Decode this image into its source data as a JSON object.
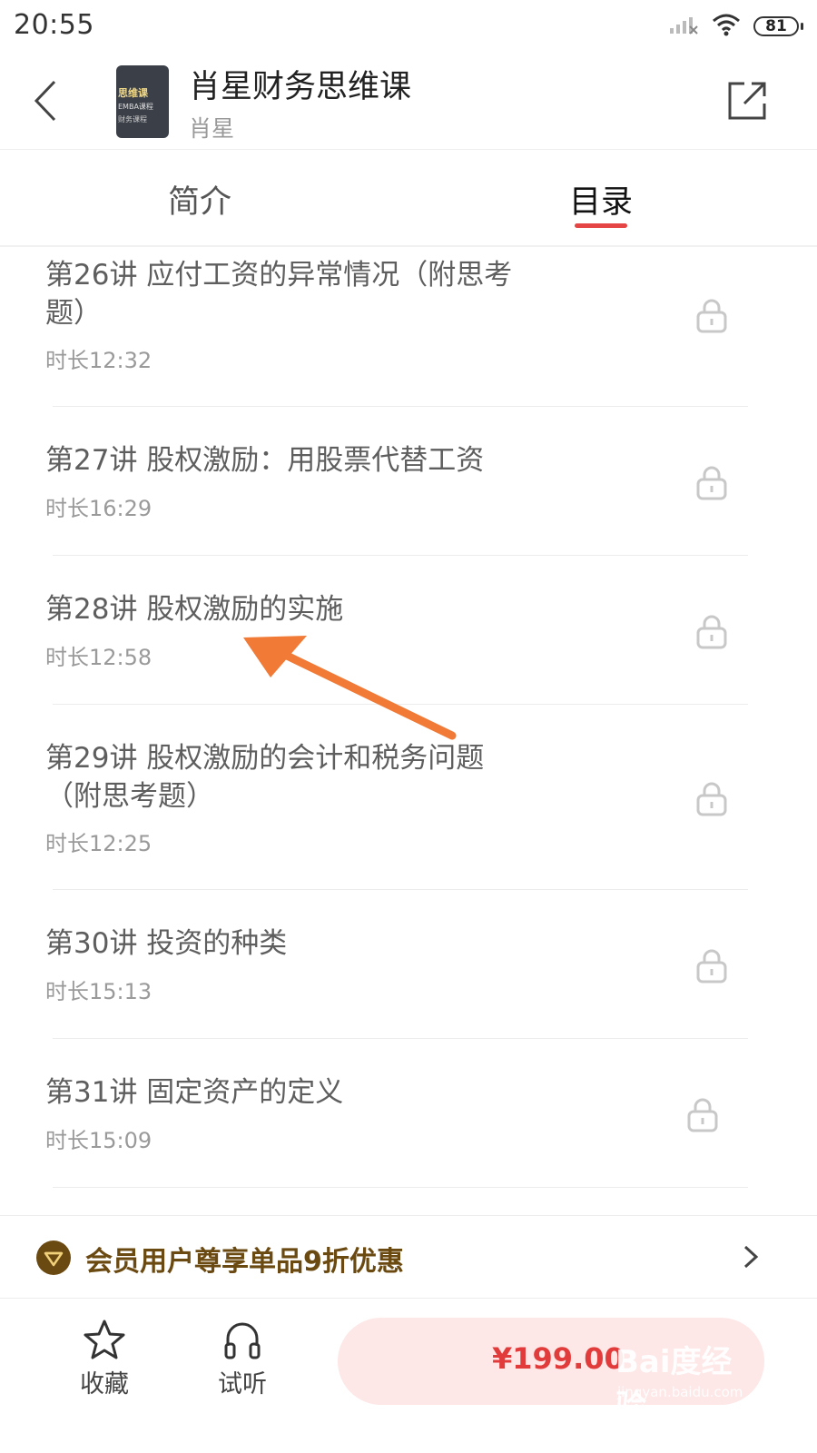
{
  "status_bar": {
    "time": "20:55",
    "battery": "81",
    "icons": [
      "signal-icon",
      "wifi-icon",
      "battery-icon"
    ]
  },
  "header": {
    "title": "肖星财务思维课",
    "author": "肖星",
    "cover_text_1": "思维课",
    "cover_text_2": "EMBA课程",
    "cover_text_3": "财务课程"
  },
  "tabs": [
    {
      "label": "简介",
      "active": false
    },
    {
      "label": "目录",
      "active": true
    }
  ],
  "lessons": [
    {
      "title": "第26讲 应付工资的异常情况（附思考题）",
      "duration": "时长12:32",
      "locked": true
    },
    {
      "title": "第27讲 股权激励：用股票代替工资",
      "duration": "时长16:29",
      "locked": true
    },
    {
      "title": "第28讲 股权激励的实施",
      "duration": "时长12:58",
      "locked": true
    },
    {
      "title": "第29讲 股权激励的会计和税务问题（附思考题）",
      "duration": "时长12:25",
      "locked": true
    },
    {
      "title": "第30讲 投资的种类",
      "duration": "时长15:13",
      "locked": true
    },
    {
      "title": "第31讲 固定资产的定义",
      "duration": "时长15:09",
      "locked": true
    }
  ],
  "member_banner": {
    "text": "会员用户尊享单品9折优惠"
  },
  "bottom_bar": {
    "collect_label": "收藏",
    "trial_label": "试听",
    "price": "¥199.00"
  },
  "watermark": {
    "main": "Bai度经验",
    "sub": "jingyan.baidu.com"
  },
  "colors": {
    "accent": "#e54545",
    "price": "#e23b3b",
    "buy_bg": "#fde7e7",
    "member_text": "#6b4a12",
    "arrow": "#f07a36"
  }
}
